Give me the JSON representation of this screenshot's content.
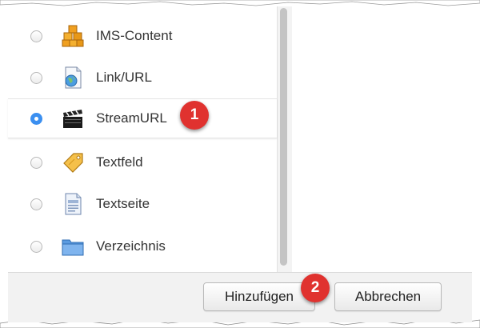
{
  "list": {
    "items": [
      {
        "label": "IMS-Content",
        "icon": "package-boxes-icon",
        "checked": false
      },
      {
        "label": "Link/URL",
        "icon": "link-document-icon",
        "checked": false
      },
      {
        "label": "StreamURL",
        "icon": "clapperboard-icon",
        "checked": true
      },
      {
        "label": "Textfeld",
        "icon": "tag-icon",
        "checked": false
      },
      {
        "label": "Textseite",
        "icon": "text-page-icon",
        "checked": false
      },
      {
        "label": "Verzeichnis",
        "icon": "folder-icon",
        "checked": false
      }
    ]
  },
  "footer": {
    "add_label": "Hinzufügen",
    "cancel_label": "Abbrechen"
  },
  "annotations": {
    "marker_1": "1",
    "marker_2": "2"
  },
  "colors": {
    "radio_selected": "#3b8ff0",
    "badge": "#e0322f"
  }
}
